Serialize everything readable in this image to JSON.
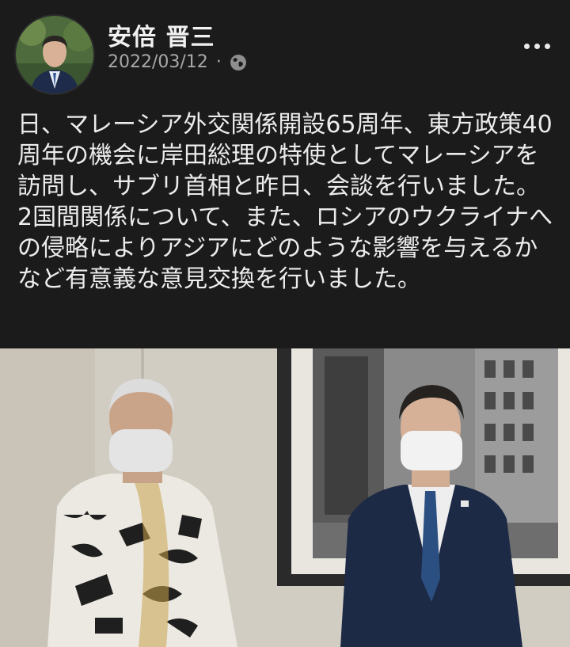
{
  "post": {
    "author": "安倍 晋三",
    "date": "2022/03/12",
    "separator": "·",
    "privacy_icon": "globe-icon",
    "more_icon": "more-dots-icon",
    "paragraph1": "日、マレーシア外交関係開設65周年、東方政策40周年の機会に岸田総理の特使としてマレーシアを訪問し、サブリ首相と昨日、会談を行いました。",
    "paragraph2": "2国間関係について、また、ロシアのウクライナへの侵略によりアジアにどのような影響を与えるかなど有意義な意見交換を行いました。"
  },
  "colors": {
    "background": "#1b1b1b",
    "text": "#ececec",
    "meta": "#a8a8a8"
  }
}
